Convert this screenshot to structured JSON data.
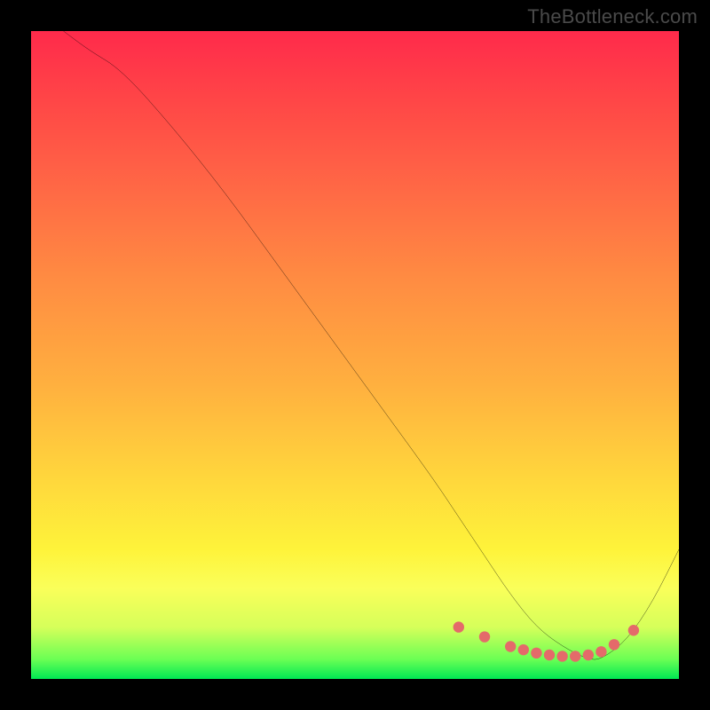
{
  "watermark": "TheBottleneck.com",
  "chart_data": {
    "type": "line",
    "title": "",
    "xlabel": "",
    "ylabel": "",
    "xlim": [
      0,
      100
    ],
    "ylim": [
      0,
      100
    ],
    "series": [
      {
        "name": "curve",
        "x": [
          5,
          9,
          14,
          22,
          30,
          38,
          46,
          54,
          62,
          66,
          70,
          74,
          78,
          82,
          86,
          88,
          92,
          96,
          100
        ],
        "y": [
          100,
          97,
          94,
          85,
          75,
          64,
          53,
          42,
          31,
          25,
          19,
          13,
          8,
          5,
          3,
          3,
          6,
          12,
          20
        ]
      }
    ],
    "markers": {
      "x": [
        66,
        70,
        74,
        76,
        78,
        80,
        82,
        84,
        86,
        88,
        90,
        93
      ],
      "y": [
        8,
        6.5,
        5,
        4.5,
        4,
        3.7,
        3.5,
        3.5,
        3.7,
        4.2,
        5.3,
        7.5
      ]
    },
    "gradient_stops": [
      {
        "pos": 0,
        "color": "#ff2a4b"
      },
      {
        "pos": 10,
        "color": "#ff4447"
      },
      {
        "pos": 25,
        "color": "#ff6a45"
      },
      {
        "pos": 38,
        "color": "#ff8b42"
      },
      {
        "pos": 55,
        "color": "#ffb13f"
      },
      {
        "pos": 70,
        "color": "#ffd93c"
      },
      {
        "pos": 80,
        "color": "#fef33a"
      },
      {
        "pos": 86,
        "color": "#faff5a"
      },
      {
        "pos": 92,
        "color": "#d6ff5a"
      },
      {
        "pos": 97,
        "color": "#6aff54"
      },
      {
        "pos": 100,
        "color": "#00e853"
      }
    ],
    "colors": {
      "curve": "#000000",
      "marker": "#e46a6a",
      "background_frame": "#000000"
    }
  }
}
